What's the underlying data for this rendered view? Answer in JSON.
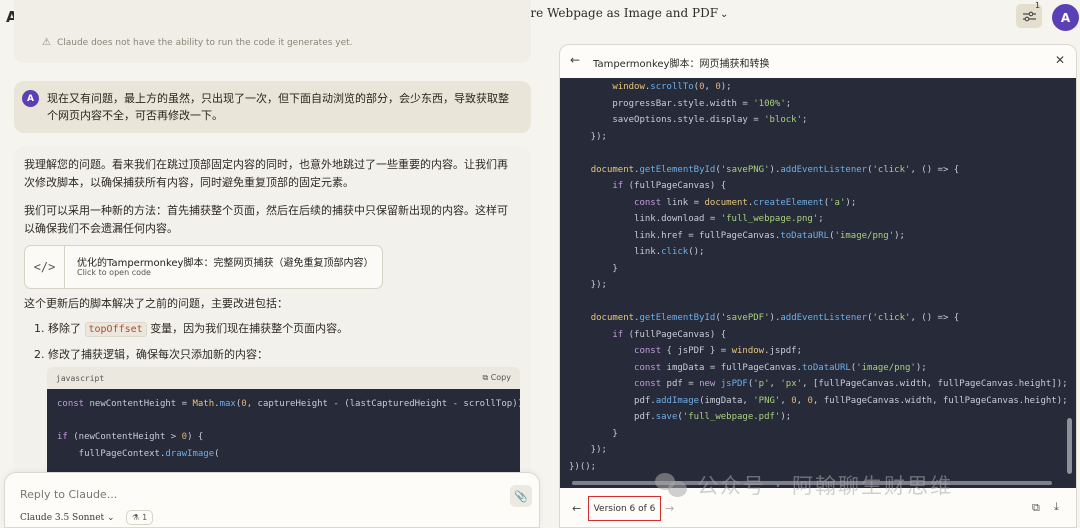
{
  "topbar": {
    "logo": "AI\\",
    "new_chat": "+",
    "title": "Tampermonkey Script: Capture Webpage as Image and PDF",
    "title_chevron": "⌄",
    "settings_badge": "1",
    "user_initial": "A"
  },
  "chat": {
    "prev_notice": "Claude does not have the ability to run the code it generates yet.",
    "user_message": {
      "avatar": "A",
      "text": "现在又有问题，最上方的虽然，只出现了一次，但下面自动浏览的部分，会少东西，导致获取整个网页内容不全，可否再修改一下。"
    },
    "ai_message": {
      "p1": "我理解您的问题。看来我们在跳过顶部固定内容的同时，也意外地跳过了一些重要的内容。让我们再次修改脚本，以确保捕获所有内容，同时避免重复顶部的固定元素。",
      "p2": "我们可以采用一种新的方法：首先捕获整个页面，然后在后续的捕获中只保留新出现的内容。这样可以确保我们不会遗漏任何内容。",
      "artifact": {
        "title": "优化的Tampermonkey脚本：完整网页捕获（避免重复顶部内容）",
        "subtitle": "Click to open code"
      },
      "p3": "这个更新后的脚本解决了之前的问题，主要改进包括：",
      "list": [
        {
          "num": "1.",
          "pre": "移除了",
          "code": "topOffset",
          "post": "变量，因为我们现在捕获整个页面内容。"
        },
        {
          "num": "2.",
          "pre": "修改了捕获逻辑，确保每次只添加新的内容：",
          "code": "",
          "post": ""
        }
      ],
      "code_block": {
        "lang": "javascript",
        "copy_label": "Copy"
      }
    }
  },
  "reply": {
    "placeholder": "Reply to Claude...",
    "model": "Claude 3.5 Sonnet",
    "model_chevron": "⌄",
    "badge_count": "1"
  },
  "panel": {
    "title": "Tampermonkey脚本：网页捕获和转换",
    "version": "Version 6 of 6"
  },
  "watermark": "公众号 · 阿翰聊生财思维"
}
